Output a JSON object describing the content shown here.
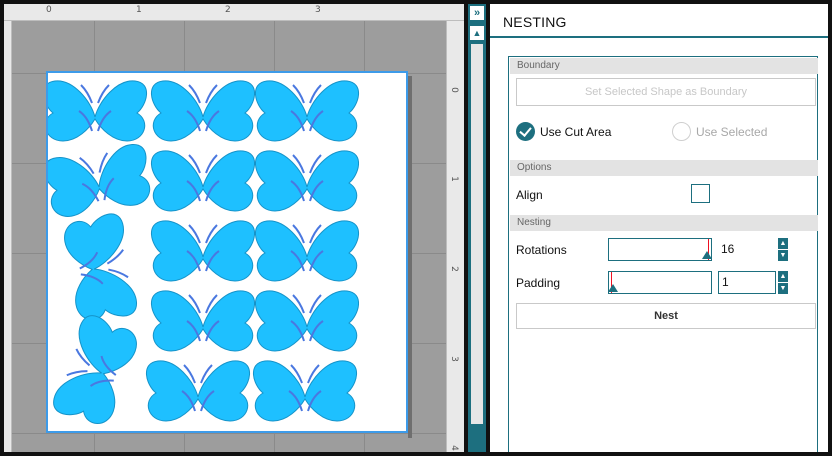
{
  "ruler": {
    "top_numbers": [
      "0",
      "1",
      "2",
      "3"
    ],
    "right_numbers": [
      "0",
      "1",
      "2",
      "3",
      "4"
    ]
  },
  "canvas": {
    "shape_color": "#1ec0ff",
    "antenna_color": "#4a78e0",
    "mat_border": "#3d9be9"
  },
  "splitter": {
    "collapse_icon": "»",
    "up_icon": "▲"
  },
  "panel": {
    "title": "NESTING",
    "boundary": {
      "header": "Boundary",
      "set_boundary_button": "Set Selected Shape as Boundary",
      "use_cut_area": "Use Cut Area",
      "use_selected": "Use Selected"
    },
    "options": {
      "header": "Options",
      "align_label": "Align"
    },
    "nesting": {
      "header": "Nesting",
      "rotations_label": "Rotations",
      "rotations_value": "16",
      "padding_label": "Padding",
      "padding_value": "1",
      "nest_button": "Nest"
    }
  },
  "colors": {
    "accent": "#1d6f7f"
  }
}
